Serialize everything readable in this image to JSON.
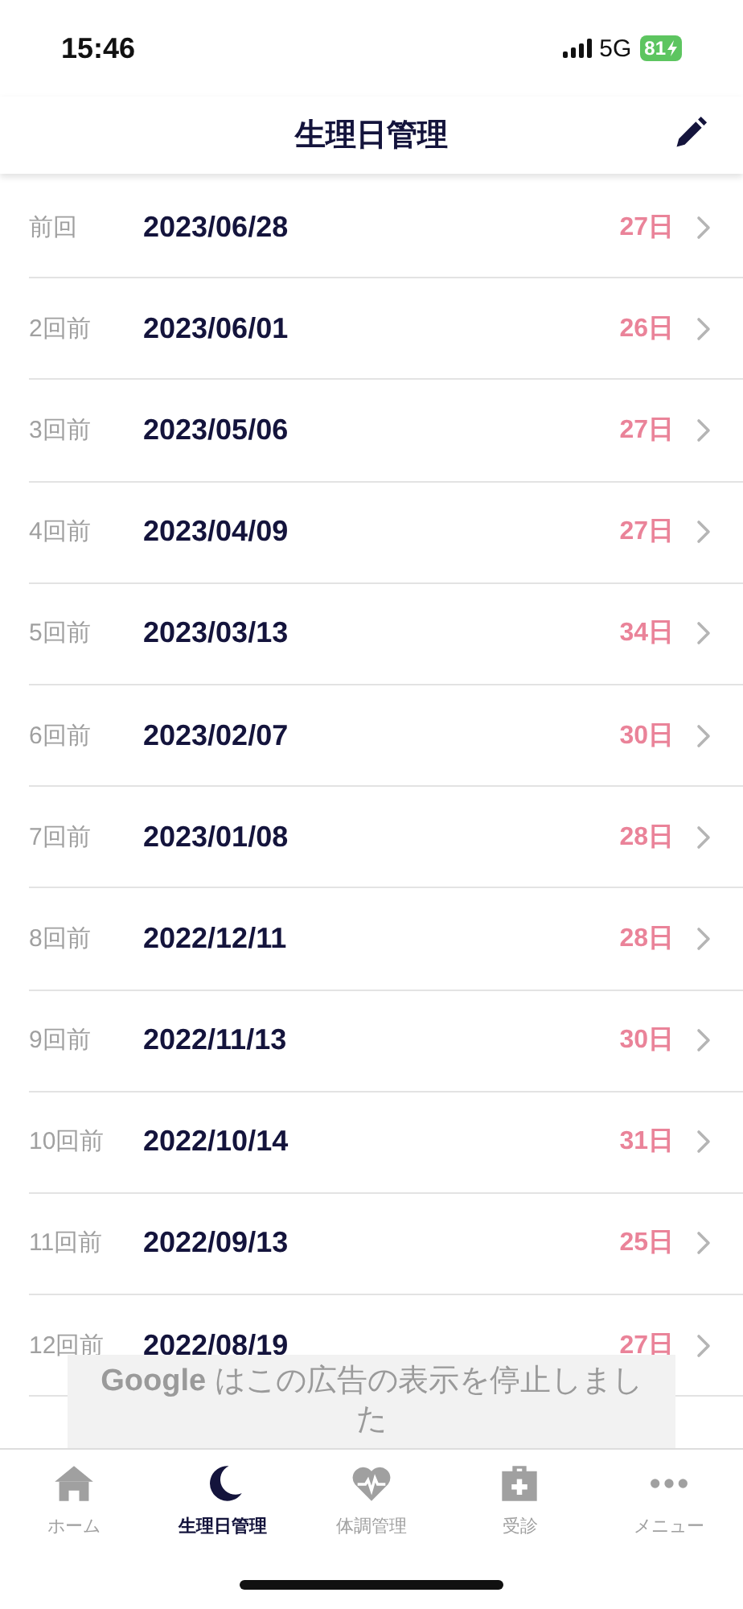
{
  "status_bar": {
    "time": "15:46",
    "network": "5G",
    "battery": "81"
  },
  "header": {
    "title": "生理日管理"
  },
  "periods": [
    {
      "label": "前回",
      "date": "2023/06/28",
      "cycle": "27日"
    },
    {
      "label": "2回前",
      "date": "2023/06/01",
      "cycle": "26日"
    },
    {
      "label": "3回前",
      "date": "2023/05/06",
      "cycle": "27日"
    },
    {
      "label": "4回前",
      "date": "2023/04/09",
      "cycle": "27日"
    },
    {
      "label": "5回前",
      "date": "2023/03/13",
      "cycle": "34日"
    },
    {
      "label": "6回前",
      "date": "2023/02/07",
      "cycle": "30日"
    },
    {
      "label": "7回前",
      "date": "2023/01/08",
      "cycle": "28日"
    },
    {
      "label": "8回前",
      "date": "2022/12/11",
      "cycle": "28日"
    },
    {
      "label": "9回前",
      "date": "2022/11/13",
      "cycle": "30日"
    },
    {
      "label": "10回前",
      "date": "2022/10/14",
      "cycle": "31日"
    },
    {
      "label": "11回前",
      "date": "2022/09/13",
      "cycle": "25日"
    },
    {
      "label": "12回前",
      "date": "2022/08/19",
      "cycle": "27日"
    }
  ],
  "ad": {
    "brand": "Google",
    "message": "はこの広告の表示を停止しました"
  },
  "tabs": [
    {
      "label": "ホーム",
      "selected": false
    },
    {
      "label": "生理日管理",
      "selected": true
    },
    {
      "label": "体調管理",
      "selected": false
    },
    {
      "label": "受診",
      "selected": false
    },
    {
      "label": "メニュー",
      "selected": false
    }
  ]
}
